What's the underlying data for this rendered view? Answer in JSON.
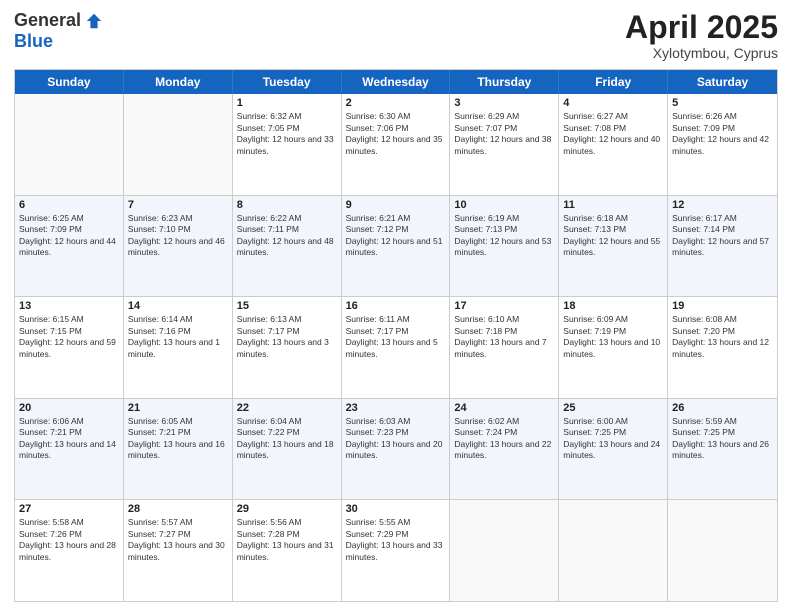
{
  "logo": {
    "general": "General",
    "blue": "Blue"
  },
  "title": {
    "month": "April 2025",
    "location": "Xylotymbou, Cyprus"
  },
  "header_days": [
    "Sunday",
    "Monday",
    "Tuesday",
    "Wednesday",
    "Thursday",
    "Friday",
    "Saturday"
  ],
  "weeks": [
    [
      {
        "day": "",
        "info": ""
      },
      {
        "day": "",
        "info": ""
      },
      {
        "day": "1",
        "info": "Sunrise: 6:32 AM\nSunset: 7:05 PM\nDaylight: 12 hours and 33 minutes."
      },
      {
        "day": "2",
        "info": "Sunrise: 6:30 AM\nSunset: 7:06 PM\nDaylight: 12 hours and 35 minutes."
      },
      {
        "day": "3",
        "info": "Sunrise: 6:29 AM\nSunset: 7:07 PM\nDaylight: 12 hours and 38 minutes."
      },
      {
        "day": "4",
        "info": "Sunrise: 6:27 AM\nSunset: 7:08 PM\nDaylight: 12 hours and 40 minutes."
      },
      {
        "day": "5",
        "info": "Sunrise: 6:26 AM\nSunset: 7:09 PM\nDaylight: 12 hours and 42 minutes."
      }
    ],
    [
      {
        "day": "6",
        "info": "Sunrise: 6:25 AM\nSunset: 7:09 PM\nDaylight: 12 hours and 44 minutes."
      },
      {
        "day": "7",
        "info": "Sunrise: 6:23 AM\nSunset: 7:10 PM\nDaylight: 12 hours and 46 minutes."
      },
      {
        "day": "8",
        "info": "Sunrise: 6:22 AM\nSunset: 7:11 PM\nDaylight: 12 hours and 48 minutes."
      },
      {
        "day": "9",
        "info": "Sunrise: 6:21 AM\nSunset: 7:12 PM\nDaylight: 12 hours and 51 minutes."
      },
      {
        "day": "10",
        "info": "Sunrise: 6:19 AM\nSunset: 7:13 PM\nDaylight: 12 hours and 53 minutes."
      },
      {
        "day": "11",
        "info": "Sunrise: 6:18 AM\nSunset: 7:13 PM\nDaylight: 12 hours and 55 minutes."
      },
      {
        "day": "12",
        "info": "Sunrise: 6:17 AM\nSunset: 7:14 PM\nDaylight: 12 hours and 57 minutes."
      }
    ],
    [
      {
        "day": "13",
        "info": "Sunrise: 6:15 AM\nSunset: 7:15 PM\nDaylight: 12 hours and 59 minutes."
      },
      {
        "day": "14",
        "info": "Sunrise: 6:14 AM\nSunset: 7:16 PM\nDaylight: 13 hours and 1 minute."
      },
      {
        "day": "15",
        "info": "Sunrise: 6:13 AM\nSunset: 7:17 PM\nDaylight: 13 hours and 3 minutes."
      },
      {
        "day": "16",
        "info": "Sunrise: 6:11 AM\nSunset: 7:17 PM\nDaylight: 13 hours and 5 minutes."
      },
      {
        "day": "17",
        "info": "Sunrise: 6:10 AM\nSunset: 7:18 PM\nDaylight: 13 hours and 7 minutes."
      },
      {
        "day": "18",
        "info": "Sunrise: 6:09 AM\nSunset: 7:19 PM\nDaylight: 13 hours and 10 minutes."
      },
      {
        "day": "19",
        "info": "Sunrise: 6:08 AM\nSunset: 7:20 PM\nDaylight: 13 hours and 12 minutes."
      }
    ],
    [
      {
        "day": "20",
        "info": "Sunrise: 6:06 AM\nSunset: 7:21 PM\nDaylight: 13 hours and 14 minutes."
      },
      {
        "day": "21",
        "info": "Sunrise: 6:05 AM\nSunset: 7:21 PM\nDaylight: 13 hours and 16 minutes."
      },
      {
        "day": "22",
        "info": "Sunrise: 6:04 AM\nSunset: 7:22 PM\nDaylight: 13 hours and 18 minutes."
      },
      {
        "day": "23",
        "info": "Sunrise: 6:03 AM\nSunset: 7:23 PM\nDaylight: 13 hours and 20 minutes."
      },
      {
        "day": "24",
        "info": "Sunrise: 6:02 AM\nSunset: 7:24 PM\nDaylight: 13 hours and 22 minutes."
      },
      {
        "day": "25",
        "info": "Sunrise: 6:00 AM\nSunset: 7:25 PM\nDaylight: 13 hours and 24 minutes."
      },
      {
        "day": "26",
        "info": "Sunrise: 5:59 AM\nSunset: 7:25 PM\nDaylight: 13 hours and 26 minutes."
      }
    ],
    [
      {
        "day": "27",
        "info": "Sunrise: 5:58 AM\nSunset: 7:26 PM\nDaylight: 13 hours and 28 minutes."
      },
      {
        "day": "28",
        "info": "Sunrise: 5:57 AM\nSunset: 7:27 PM\nDaylight: 13 hours and 30 minutes."
      },
      {
        "day": "29",
        "info": "Sunrise: 5:56 AM\nSunset: 7:28 PM\nDaylight: 13 hours and 31 minutes."
      },
      {
        "day": "30",
        "info": "Sunrise: 5:55 AM\nSunset: 7:29 PM\nDaylight: 13 hours and 33 minutes."
      },
      {
        "day": "",
        "info": ""
      },
      {
        "day": "",
        "info": ""
      },
      {
        "day": "",
        "info": ""
      }
    ]
  ]
}
